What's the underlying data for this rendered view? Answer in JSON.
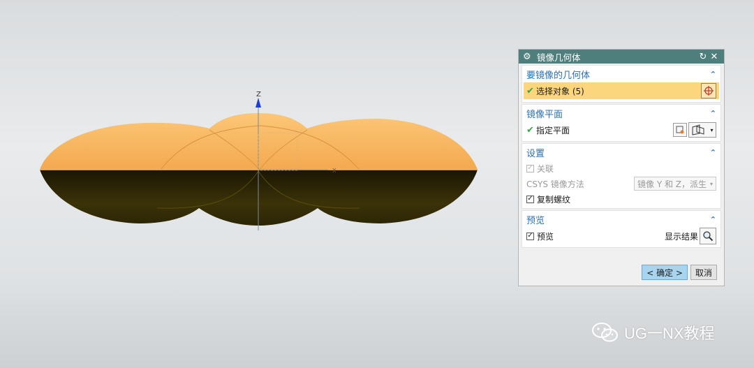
{
  "viewport": {
    "axis_z": "Z",
    "axis_x": "X"
  },
  "dialog": {
    "title": "镜像几何体",
    "sections": {
      "geometry": {
        "title": "要镜像的几何体",
        "select_label": "选择对象 (5)"
      },
      "plane": {
        "title": "镜像平面",
        "specify_label": "指定平面"
      },
      "settings": {
        "title": "设置",
        "associative_label": "关联",
        "csys_label": "CSYS 镜像方法",
        "csys_value": "镜像 Y 和 Z，派生",
        "copy_thread_label": "复制螺纹"
      },
      "preview": {
        "title": "预览",
        "preview_label": "预览",
        "show_result_label": "显示结果"
      }
    },
    "buttons": {
      "ok": "< 确定 >",
      "cancel": "取消"
    }
  },
  "watermark": {
    "text": "UG一NX教程"
  },
  "colors": {
    "titlebar": "#4f7f7c",
    "section_title": "#2a6fb0",
    "selected_row": "#fbd67d",
    "model_orange": "#f8b45a"
  }
}
